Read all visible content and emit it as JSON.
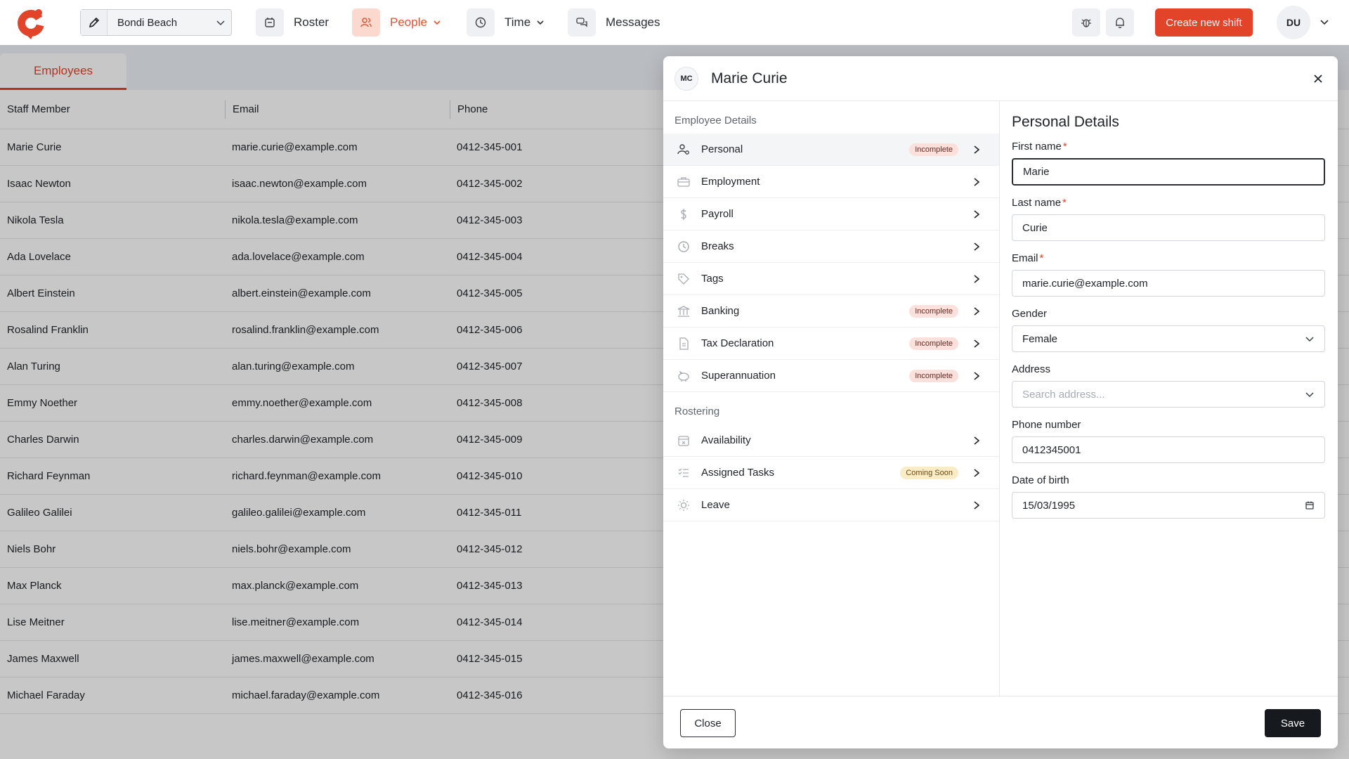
{
  "topbar": {
    "location": "Bondi Beach",
    "nav": [
      {
        "label": "Roster"
      },
      {
        "label": "People"
      },
      {
        "label": "Time"
      },
      {
        "label": "Messages"
      }
    ],
    "create_button": "Create new shift",
    "user_initials": "DU"
  },
  "background": {
    "tab": "Employees",
    "columns": [
      "Staff Member",
      "Email",
      "Phone"
    ],
    "rows": [
      {
        "name": "Marie Curie",
        "email": "marie.curie@example.com",
        "phone": "0412-345-001"
      },
      {
        "name": "Isaac Newton",
        "email": "isaac.newton@example.com",
        "phone": "0412-345-002"
      },
      {
        "name": "Nikola Tesla",
        "email": "nikola.tesla@example.com",
        "phone": "0412-345-003"
      },
      {
        "name": "Ada Lovelace",
        "email": "ada.lovelace@example.com",
        "phone": "0412-345-004"
      },
      {
        "name": "Albert Einstein",
        "email": "albert.einstein@example.com",
        "phone": "0412-345-005"
      },
      {
        "name": "Rosalind Franklin",
        "email": "rosalind.franklin@example.com",
        "phone": "0412-345-006"
      },
      {
        "name": "Alan Turing",
        "email": "alan.turing@example.com",
        "phone": "0412-345-007"
      },
      {
        "name": "Emmy Noether",
        "email": "emmy.noether@example.com",
        "phone": "0412-345-008"
      },
      {
        "name": "Charles Darwin",
        "email": "charles.darwin@example.com",
        "phone": "0412-345-009"
      },
      {
        "name": "Richard Feynman",
        "email": "richard.feynman@example.com",
        "phone": "0412-345-010"
      },
      {
        "name": "Galileo Galilei",
        "email": "galileo.galilei@example.com",
        "phone": "0412-345-011"
      },
      {
        "name": "Niels Bohr",
        "email": "niels.bohr@example.com",
        "phone": "0412-345-012"
      },
      {
        "name": "Max Planck",
        "email": "max.planck@example.com",
        "phone": "0412-345-013"
      },
      {
        "name": "Lise Meitner",
        "email": "lise.meitner@example.com",
        "phone": "0412-345-014"
      },
      {
        "name": "James Maxwell",
        "email": "james.maxwell@example.com",
        "phone": "0412-345-015"
      },
      {
        "name": "Michael Faraday",
        "email": "michael.faraday@example.com",
        "phone": "0412-345-016"
      }
    ]
  },
  "modal": {
    "initials": "MC",
    "title": "Marie Curie",
    "employee_details_title": "Employee Details",
    "employee_items": [
      {
        "label": "Personal",
        "badge": "Incomplete",
        "icon": "user-gear-icon"
      },
      {
        "label": "Employment",
        "badge": "",
        "icon": "briefcase-icon"
      },
      {
        "label": "Payroll",
        "badge": "",
        "icon": "dollar-icon"
      },
      {
        "label": "Breaks",
        "badge": "",
        "icon": "clock-icon"
      },
      {
        "label": "Tags",
        "badge": "",
        "icon": "tag-icon"
      },
      {
        "label": "Banking",
        "badge": "Incomplete",
        "icon": "bank-icon"
      },
      {
        "label": "Tax Declaration",
        "badge": "Incomplete",
        "icon": "document-icon"
      },
      {
        "label": "Superannuation",
        "badge": "Incomplete",
        "icon": "piggy-bank-icon"
      }
    ],
    "rostering_title": "Rostering",
    "rostering_items": [
      {
        "label": "Availability",
        "badge": "",
        "icon": "calendar-x-icon"
      },
      {
        "label": "Assigned Tasks",
        "badge": "Coming Soon",
        "icon": "checklist-icon"
      },
      {
        "label": "Leave",
        "badge": "",
        "icon": "sun-icon"
      }
    ],
    "personal_details": {
      "title": "Personal Details",
      "first_name_label": "First name",
      "first_name": "Marie",
      "last_name_label": "Last name",
      "last_name": "Curie",
      "email_label": "Email",
      "email": "marie.curie@example.com",
      "gender_label": "Gender",
      "gender": "Female",
      "address_label": "Address",
      "address_placeholder": "Search address...",
      "phone_label": "Phone number",
      "phone": "0412345001",
      "dob_label": "Date of birth",
      "dob": "15/03/1995",
      "required_mark": "*"
    },
    "close_button": "Close",
    "save_button": "Save"
  },
  "colors": {
    "brand": "#e2442a",
    "nav_active": "#e8502e"
  }
}
